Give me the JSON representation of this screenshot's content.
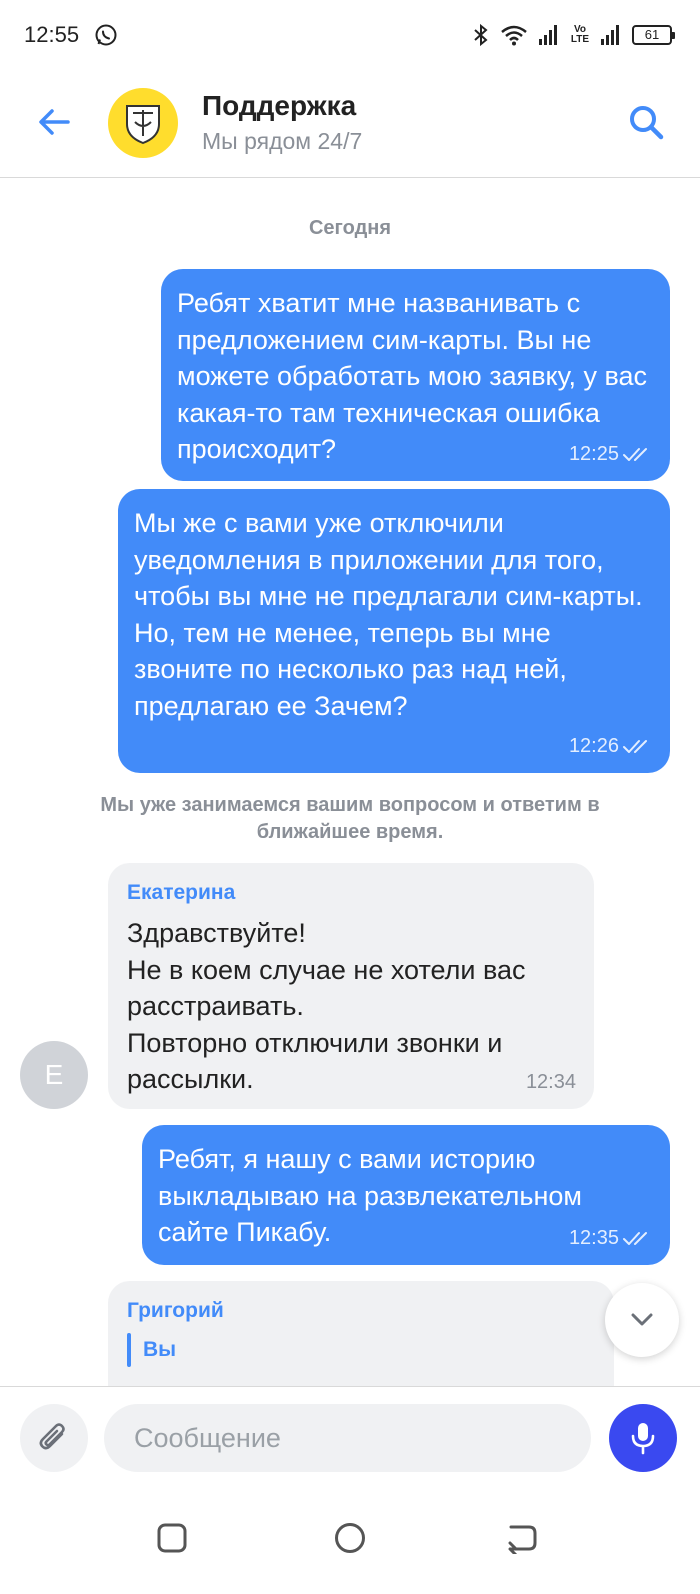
{
  "status_bar": {
    "time": "12:55",
    "volte": "Vo LTE",
    "battery": "61",
    "icons": [
      "whatsapp-icon",
      "bluetooth-icon",
      "wifi-icon",
      "signal-icon",
      "signal-icon",
      "battery-icon"
    ]
  },
  "header": {
    "title": "Поддержка",
    "subtitle": "Мы рядом 24/7",
    "icons": [
      "back-arrow-icon",
      "bank-logo",
      "search-icon"
    ]
  },
  "chat": {
    "date_separator": "Сегодня",
    "messages": [
      {
        "direction": "outgoing",
        "text": "Ребят хватит мне названивать с предложением сим-карты. Вы не можете обработать мою заявку, у вас какая-то там техническая ошибка происходит?",
        "time": "12:25",
        "status": "read"
      },
      {
        "direction": "outgoing",
        "text": "Мы же с вами уже отключили уведомления в приложении для того, чтобы вы мне не предлагали сим-карты. Но, тем не менее, теперь вы мне звоните по несколько раз над ней, предлагаю ее Зачем?",
        "time": "12:26",
        "status": "read"
      },
      {
        "direction": "system",
        "text": "Мы уже занимаемся вашим вопросом и ответим в ближайшее время."
      },
      {
        "direction": "incoming",
        "sender": "Екатерина",
        "avatar_letter": "Е",
        "text": "Здравствуйте!\nНе в коем случае не хотели вас расстраивать.\nПовторно отключили звонки и рассылки.",
        "time": "12:34"
      },
      {
        "direction": "outgoing",
        "text": "Ребят, я нашу с вами историю выкладываю на развлекательном сайте Пикабу.",
        "time": "12:35",
        "status": "read"
      },
      {
        "direction": "incoming",
        "sender": "Григорий",
        "quote_author": "Вы"
      }
    ]
  },
  "composer": {
    "placeholder": "Сообщение"
  },
  "colors": {
    "accent": "#428bf9",
    "incoming_bubble": "#f0f1f3",
    "mic_button": "#3a49f0",
    "logo_yellow": "#ffdd2d"
  }
}
